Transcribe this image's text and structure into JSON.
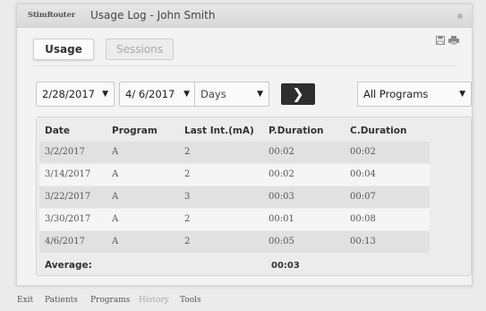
{
  "window": {
    "brand": "StimRouter",
    "title": "Usage Log - John Smith"
  },
  "tabs": [
    {
      "label": "Usage",
      "active": true
    },
    {
      "label": "Sessions",
      "active": false
    }
  ],
  "icons": {
    "save": "save-icon",
    "print": "print-icon"
  },
  "filters": {
    "start_date": "2/28/2017",
    "end_date": "4/ 6/2017",
    "period": "Days",
    "go_label": "❯",
    "program": "All Programs"
  },
  "table": {
    "columns": [
      "Date",
      "Program",
      "Last Int.(mA)",
      "P.Duration",
      "C.Duration"
    ],
    "rows": [
      [
        "3/2/2017",
        "A",
        "2",
        "00:02",
        "00:02"
      ],
      [
        "3/14/2017",
        "A",
        "2",
        "00:02",
        "00:04"
      ],
      [
        "3/22/2017",
        "A",
        "3",
        "00:03",
        "00:07"
      ],
      [
        "3/30/2017",
        "A",
        "2",
        "00:01",
        "00:08"
      ],
      [
        "4/6/2017",
        "A",
        "2",
        "00:05",
        "00:13"
      ]
    ],
    "average_label": "Average:",
    "average_p_duration": "00:03"
  },
  "nav": [
    {
      "label": "Exit",
      "dim": false
    },
    {
      "label": "Patients",
      "dim": false
    },
    {
      "label": "Programs",
      "dim": false
    },
    {
      "label": "History",
      "dim": true
    },
    {
      "label": "Tools",
      "dim": false
    }
  ],
  "colors": {
    "window_bg": "#f3f3f3",
    "go_button": "#2e2e2e",
    "row_alt": "#e1e1e1",
    "row_plain": "#f5f5f5"
  }
}
